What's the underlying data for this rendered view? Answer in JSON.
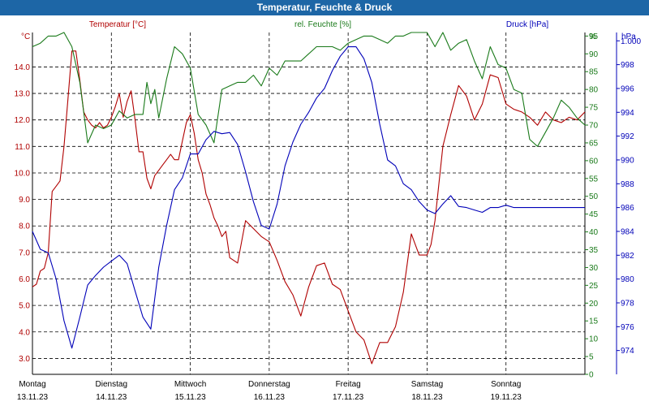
{
  "window": {
    "title": "Temperatur, Feuchte & Druck"
  },
  "colors": {
    "temperature": "#b00000",
    "humidity": "#1a7a1a",
    "pressure": "#0000b8",
    "header": "#1d66a6",
    "grid": "#000000"
  },
  "chart_data": {
    "type": "line",
    "title": "Temperatur, Feuchte & Druck",
    "xlabel": "",
    "grid": true,
    "x_ticks": [
      {
        "day": "Montag",
        "date": "13.11.23"
      },
      {
        "day": "Dienstag",
        "date": "14.11.23"
      },
      {
        "day": "Mittwoch",
        "date": "15.11.23"
      },
      {
        "day": "Donnerstag",
        "date": "16.11.23"
      },
      {
        "day": "Freitag",
        "date": "17.11.23"
      },
      {
        "day": "Samstag",
        "date": "18.11.23"
      },
      {
        "day": "Sonntag",
        "date": "19.11.23"
      }
    ],
    "xlim": [
      0,
      7
    ],
    "axes": {
      "temperature": {
        "label": "Temperatur [°C]",
        "unit": "°C",
        "ylim": [
          2.4,
          15.3
        ],
        "ticks": [
          "14.0",
          "13.0",
          "12.0",
          "11.0",
          "10.0",
          "9.0",
          "8.0",
          "7.0",
          "6.0",
          "5.0",
          "4.0",
          "3.0"
        ]
      },
      "humidity": {
        "label": "rel. Feuchte [%]",
        "unit": "%",
        "ylim": [
          0,
          96
        ],
        "ticks": [
          "95",
          "90",
          "85",
          "80",
          "75",
          "70",
          "65",
          "60",
          "55",
          "50",
          "45",
          "40",
          "35",
          "30",
          "25",
          "20",
          "15",
          "10",
          "5",
          "0"
        ]
      },
      "pressure": {
        "label": "Druck [hPa]",
        "unit": "hPa",
        "ylim": [
          972,
          1000.7
        ],
        "ticks": [
          "1.000",
          "998",
          "996",
          "994",
          "992",
          "990",
          "988",
          "986",
          "984",
          "982",
          "980",
          "978",
          "976",
          "974"
        ]
      }
    },
    "series": [
      {
        "name": "Temperatur [°C]",
        "axis": "temperature",
        "x": [
          0,
          0.05,
          0.1,
          0.15,
          0.2,
          0.25,
          0.3,
          0.35,
          0.4,
          0.45,
          0.5,
          0.55,
          0.6,
          0.65,
          0.7,
          0.75,
          0.8,
          0.85,
          0.9,
          0.95,
          1.0,
          1.05,
          1.1,
          1.15,
          1.2,
          1.25,
          1.3,
          1.35,
          1.4,
          1.45,
          1.5,
          1.55,
          1.6,
          1.65,
          1.7,
          1.75,
          1.8,
          1.85,
          1.9,
          1.95,
          2.0,
          2.05,
          2.1,
          2.15,
          2.2,
          2.25,
          2.3,
          2.35,
          2.4,
          2.45,
          2.5,
          2.55,
          2.6,
          2.65,
          2.7,
          2.8,
          2.9,
          3.0,
          3.1,
          3.2,
          3.3,
          3.4,
          3.5,
          3.6,
          3.7,
          3.8,
          3.9,
          4.0,
          4.1,
          4.2,
          4.3,
          4.4,
          4.5,
          4.6,
          4.7,
          4.8,
          4.9,
          5.0,
          5.05,
          5.1,
          5.2,
          5.3,
          5.4,
          5.5,
          5.6,
          5.7,
          5.8,
          5.9,
          6.0,
          6.1,
          6.2,
          6.3,
          6.4,
          6.5,
          6.6,
          6.7,
          6.8,
          6.9,
          7.0
        ],
        "values": [
          5.7,
          5.8,
          6.3,
          6.4,
          7.0,
          9.3,
          9.5,
          9.7,
          11.0,
          12.8,
          14.6,
          14.6,
          13.5,
          12.3,
          12.0,
          11.8,
          11.7,
          11.9,
          11.7,
          11.8,
          12.1,
          12.5,
          13.0,
          12.1,
          12.7,
          13.1,
          12.0,
          10.8,
          10.8,
          9.8,
          9.4,
          9.9,
          10.1,
          10.3,
          10.5,
          10.7,
          10.5,
          10.5,
          11.2,
          11.9,
          12.2,
          11.5,
          10.5,
          10.0,
          9.2,
          8.8,
          8.3,
          8.0,
          7.6,
          7.8,
          6.8,
          6.7,
          6.6,
          7.4,
          8.2,
          7.9,
          7.6,
          7.4,
          6.7,
          5.9,
          5.4,
          4.6,
          5.7,
          6.5,
          6.6,
          5.8,
          5.6,
          4.8,
          4.0,
          3.7,
          2.8,
          3.6,
          3.6,
          4.2,
          5.5,
          7.7,
          6.9,
          6.9,
          7.3,
          8.2,
          11.0,
          12.2,
          13.3,
          12.9,
          12.0,
          12.6,
          13.7,
          13.6,
          12.6,
          12.4,
          12.3,
          12.1,
          11.8,
          12.3,
          12.0,
          11.9,
          12.1,
          12.0,
          12.3
        ],
        "x_alt": [],
        "values_alt": []
      },
      {
        "name": "rel. Feuchte [%]",
        "axis": "humidity",
        "x": [
          0,
          0.1,
          0.2,
          0.3,
          0.4,
          0.5,
          0.6,
          0.7,
          0.8,
          0.9,
          1.0,
          1.1,
          1.2,
          1.3,
          1.4,
          1.45,
          1.5,
          1.55,
          1.6,
          1.7,
          1.8,
          1.9,
          2.0,
          2.1,
          2.2,
          2.3,
          2.4,
          2.5,
          2.6,
          2.7,
          2.8,
          2.9,
          3.0,
          3.1,
          3.2,
          3.3,
          3.4,
          3.5,
          3.6,
          3.7,
          3.8,
          3.9,
          4.0,
          4.1,
          4.2,
          4.3,
          4.4,
          4.5,
          4.6,
          4.7,
          4.8,
          4.9,
          5.0,
          5.1,
          5.2,
          5.3,
          5.4,
          5.5,
          5.6,
          5.7,
          5.8,
          5.9,
          6.0,
          6.1,
          6.2,
          6.3,
          6.4,
          6.5,
          6.6,
          6.7,
          6.8,
          6.9,
          7.0
        ],
        "values": [
          92,
          93,
          95,
          95,
          96,
          92,
          82,
          65,
          70,
          69,
          70,
          74,
          72,
          73,
          73,
          82,
          76,
          80,
          72,
          83,
          92,
          90,
          86,
          73,
          70,
          65,
          80,
          81,
          82,
          82,
          84,
          81,
          86,
          84,
          88,
          88,
          88,
          90,
          92,
          92,
          92,
          91,
          93,
          94,
          95,
          95,
          94,
          93,
          95,
          95,
          96,
          96,
          96,
          92,
          96,
          91,
          93,
          94,
          88,
          83,
          92,
          87,
          86,
          80,
          79,
          66,
          64,
          68,
          72,
          77,
          75,
          72,
          70
        ],
        "x_alt": [],
        "values_alt": []
      },
      {
        "name": "Druck [hPa]",
        "axis": "pressure",
        "x": [
          0,
          0.1,
          0.2,
          0.3,
          0.4,
          0.5,
          0.6,
          0.7,
          0.8,
          0.9,
          1.0,
          1.1,
          1.2,
          1.3,
          1.4,
          1.5,
          1.6,
          1.7,
          1.8,
          1.9,
          2.0,
          2.1,
          2.2,
          2.3,
          2.4,
          2.5,
          2.6,
          2.7,
          2.8,
          2.9,
          3.0,
          3.1,
          3.2,
          3.3,
          3.4,
          3.5,
          3.6,
          3.7,
          3.8,
          3.9,
          4.0,
          4.1,
          4.2,
          4.3,
          4.4,
          4.5,
          4.6,
          4.7,
          4.8,
          4.9,
          5.0,
          5.1,
          5.2,
          5.3,
          5.4,
          5.5,
          5.6,
          5.7,
          5.8,
          5.9,
          6.0,
          6.1,
          6.2,
          6.3,
          6.4,
          6.5,
          6.6,
          6.7,
          6.8,
          6.9,
          7.0
        ],
        "values": [
          984,
          982.5,
          982.2,
          980,
          976.5,
          974.2,
          976.8,
          979.5,
          980.3,
          981,
          981.5,
          982,
          981.3,
          979,
          976.8,
          975.8,
          981,
          984.5,
          987.5,
          988.5,
          990.5,
          990.5,
          991.7,
          992.4,
          992.2,
          992.3,
          991.3,
          989,
          986.5,
          984.5,
          984.2,
          986.3,
          989.5,
          991.5,
          993,
          994,
          995.2,
          996,
          997.5,
          998.7,
          999.5,
          999.5,
          998.5,
          996.5,
          993,
          990,
          989.5,
          988,
          987.5,
          986.5,
          985.8,
          985.5,
          986.3,
          987,
          986.1,
          986,
          985.8,
          985.6,
          986,
          986,
          986.2,
          986,
          986,
          986,
          986,
          986,
          986,
          986,
          986,
          986,
          986
        ],
        "x_alt": [],
        "values_alt": []
      }
    ]
  }
}
